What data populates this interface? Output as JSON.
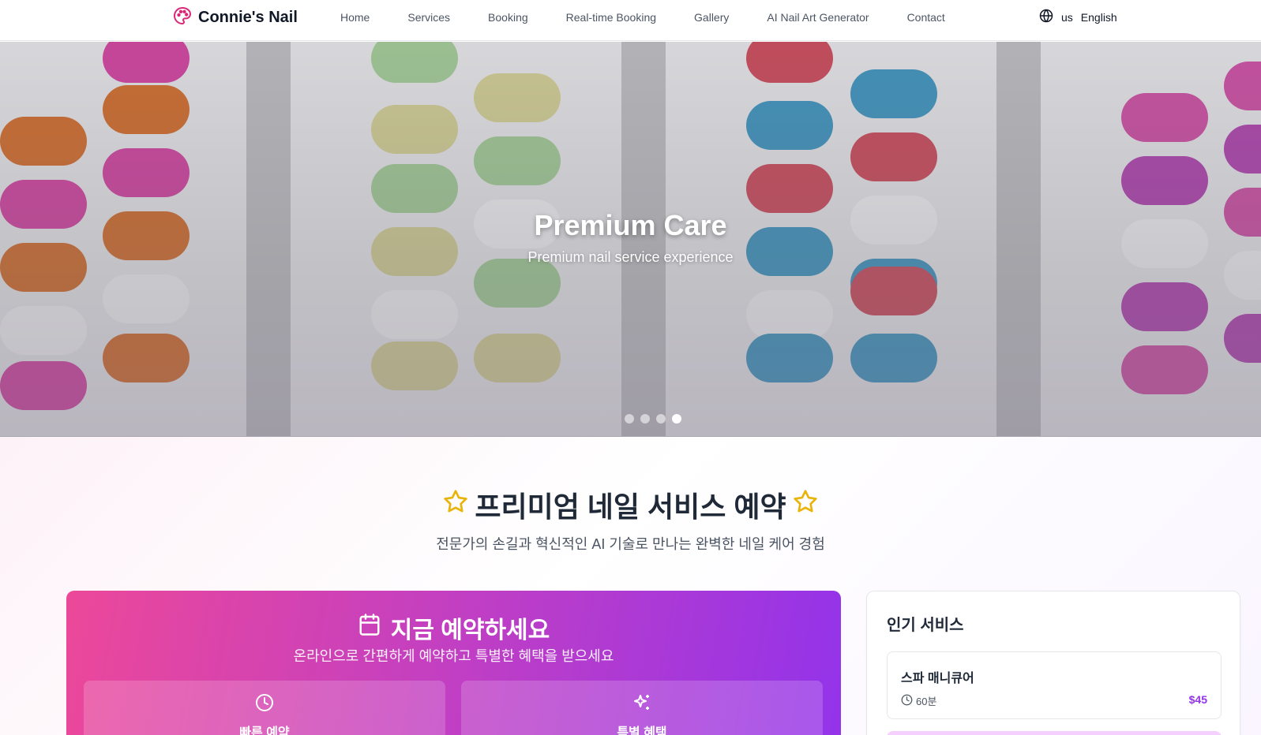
{
  "nav": {
    "brand": "Connie's Nail",
    "links": [
      "Home",
      "Services",
      "Booking",
      "Real-time Booking",
      "Gallery",
      "AI Nail Art Generator",
      "Contact"
    ],
    "region": "us",
    "language": "English"
  },
  "hero": {
    "title": "Premium Care",
    "subtitle": "Premium nail service experience",
    "slide_count": 4,
    "active_slide": 4
  },
  "section": {
    "title": "프리미엄 네일 서비스 예약",
    "subtitle": "전문가의 손길과 혁신적인 AI 기술로 만나는 완벽한 네일 케어 경험"
  },
  "booking": {
    "title": "지금 예약하세요",
    "subtitle": "온라인으로 간편하게 예약하고 특별한 혜택을 받으세요",
    "features": [
      "빠른 예약",
      "특별 혜택"
    ]
  },
  "popular": {
    "title": "인기 서비스",
    "services": [
      {
        "name": "스파 매니큐어",
        "duration": "60분",
        "price": "$45"
      }
    ]
  },
  "colors": {
    "brand_pink": "#ec4899",
    "brand_purple": "#9333ea",
    "star": "#eab308"
  }
}
